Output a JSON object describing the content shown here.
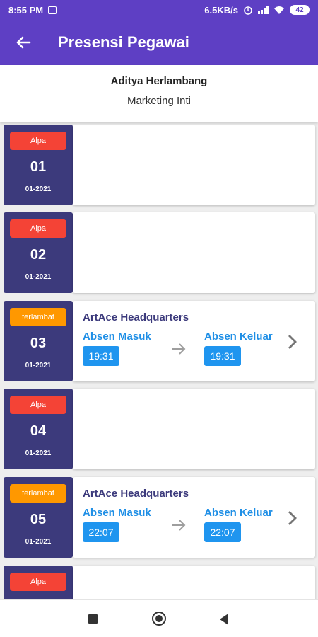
{
  "status_bar": {
    "time": "8:55 PM",
    "speed": "6.5KB/s",
    "battery": "42"
  },
  "app_bar": {
    "title": "Presensi Pegawai"
  },
  "profile": {
    "name": "Aditya Herlambang",
    "department": "Marketing Inti"
  },
  "records": [
    {
      "status": "Alpa",
      "day": "01",
      "month": "01-2021"
    },
    {
      "status": "Alpa",
      "day": "02",
      "month": "01-2021"
    },
    {
      "status": "terlambat",
      "day": "03",
      "month": "01-2021",
      "location": "ArtAce Headquarters",
      "in_label": "Absen Masuk",
      "in_time": "19:31",
      "out_label": "Absen Keluar",
      "out_time": "19:31"
    },
    {
      "status": "Alpa",
      "day": "04",
      "month": "01-2021"
    },
    {
      "status": "terlambat",
      "day": "05",
      "month": "01-2021",
      "location": "ArtAce Headquarters",
      "in_label": "Absen Masuk",
      "in_time": "22:07",
      "out_label": "Absen Keluar",
      "out_time": "22:07"
    },
    {
      "status": "Alpa"
    }
  ],
  "colors": {
    "primary": "#5e3fc4",
    "date_box": "#3c3a7c",
    "alpa": "#f44336",
    "terlambat": "#ff9800",
    "time_chip": "#1f95ef"
  }
}
